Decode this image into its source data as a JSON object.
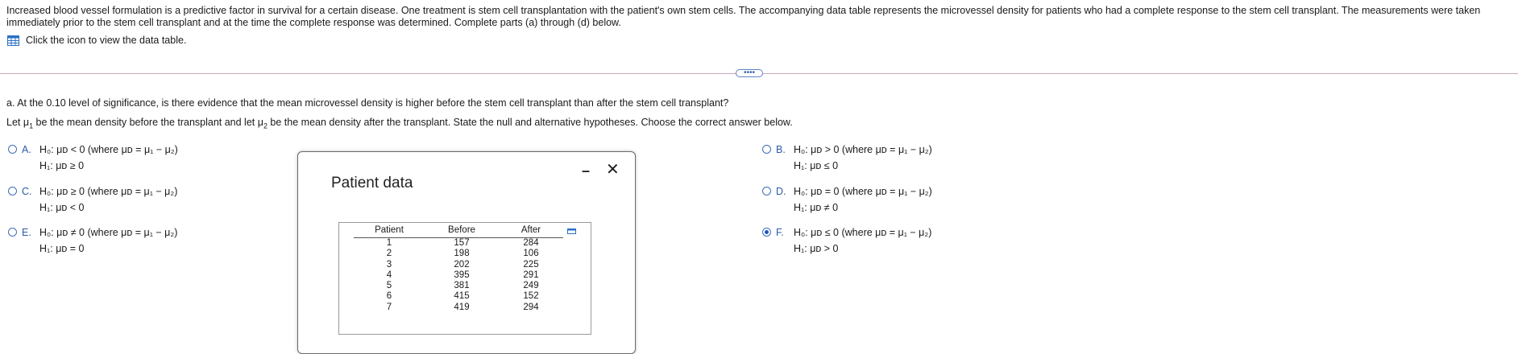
{
  "intro": "Increased blood vessel formulation is a predictive factor in survival for a certain disease. One treatment is stem cell transplantation with the patient's own stem cells. The accompanying data table represents the microvessel density for patients who had a complete response to the stem cell transplant. The measurements were taken immediately prior to the stem cell transplant and at the time the complete response was determined. Complete parts (a) through (d) below.",
  "table_link": "Click the icon to view the data table.",
  "more_button": "••••",
  "question_a": "a. At the 0.10 level of significance, is there evidence that the mean microvessel density is higher before the stem cell transplant than after the stem cell transplant?",
  "instruction": {
    "p1": "Let μ",
    "s1": "1",
    "p2": " be the mean density before the transplant and let μ",
    "s2": "2",
    "p3": " be the mean density after the transplant. State the null and alternative hypotheses. Choose the correct answer below."
  },
  "options": [
    {
      "letter": "A.",
      "h0": "H₀: μᴅ < 0 (where μᴅ = μ₁ − μ₂)",
      "h1": "H₁: μᴅ ≥ 0",
      "selected": false
    },
    {
      "letter": "B.",
      "h0": "H₀: μᴅ > 0 (where μᴅ = μ₁ − μ₂)",
      "h1": "H₁: μᴅ ≤ 0",
      "selected": false
    },
    {
      "letter": "C.",
      "h0": "H₀: μᴅ ≥ 0 (where μᴅ = μ₁ − μ₂)",
      "h1": "H₁: μᴅ < 0",
      "selected": false
    },
    {
      "letter": "D.",
      "h0": "H₀: μᴅ = 0 (where μᴅ = μ₁ − μ₂)",
      "h1": "H₁: μᴅ ≠ 0",
      "selected": false
    },
    {
      "letter": "E.",
      "h0": "H₀: μᴅ ≠ 0 (where μᴅ = μ₁ − μ₂)",
      "h1": "H₁: μᴅ = 0",
      "selected": false
    },
    {
      "letter": "F.",
      "h0": "H₀: μᴅ ≤ 0 (where μᴅ = μ₁ − μ₂)",
      "h1": "H₁: μᴅ > 0",
      "selected": true
    }
  ],
  "dialog": {
    "title": "Patient data",
    "minimize": "–",
    "close": "✕",
    "headers": [
      "Patient",
      "Before",
      "After"
    ],
    "rows": [
      [
        "1",
        "157",
        "284"
      ],
      [
        "2",
        "198",
        "106"
      ],
      [
        "3",
        "202",
        "225"
      ],
      [
        "4",
        "395",
        "291"
      ],
      [
        "5",
        "381",
        "249"
      ],
      [
        "6",
        "415",
        "152"
      ],
      [
        "7",
        "419",
        "294"
      ]
    ]
  },
  "colors": {
    "accent": "#1f55c3",
    "divider": "#c9a7b8"
  },
  "icons": {
    "table_link": "table-grid-icon",
    "copy": "copy-icon"
  }
}
